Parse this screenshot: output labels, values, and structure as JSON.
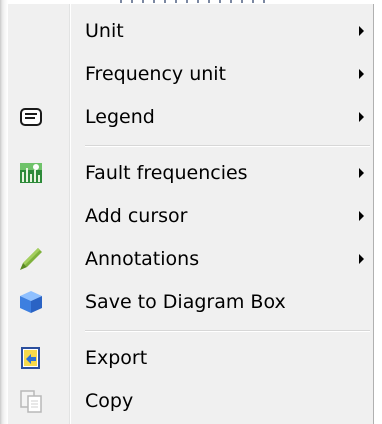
{
  "menu": {
    "items": [
      {
        "label": "Unit",
        "icon": null,
        "submenu": true
      },
      {
        "label": "Frequency unit",
        "icon": null,
        "submenu": true
      },
      {
        "label": "Legend",
        "icon": "legend-icon",
        "submenu": true
      },
      {
        "label": "Fault frequencies",
        "icon": "fault-frequencies-icon",
        "submenu": true
      },
      {
        "label": "Add cursor",
        "icon": null,
        "submenu": true
      },
      {
        "label": "Annotations",
        "icon": "pencil-icon",
        "submenu": true
      },
      {
        "label": "Save to Diagram Box",
        "icon": "cube-icon",
        "submenu": false
      },
      {
        "label": "Export",
        "icon": "export-icon",
        "submenu": false
      },
      {
        "label": "Copy",
        "icon": "copy-icon",
        "submenu": false
      }
    ]
  },
  "colors": {
    "menu_background": "#f0f0f0",
    "text": "#000000",
    "separator": "#d7d7d7",
    "cube_blue": "#3d7fe0",
    "pencil_green": "#7fb13c"
  }
}
